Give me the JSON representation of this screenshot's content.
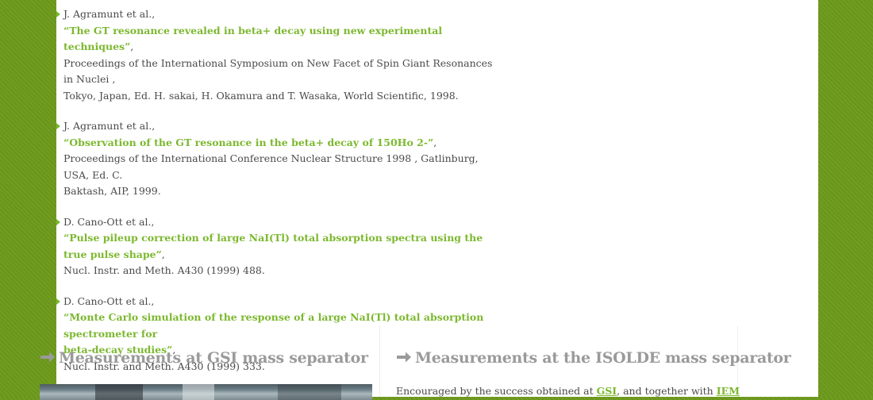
{
  "publications": [
    {
      "authors": "J. Agramunt et al.,",
      "title": "“The GT resonance revealed in beta+ decay using new experimental techniques”",
      "source_lines": [
        "Proceedings of the International Symposium on New Facet of Spin Giant Resonances in Nuclei ,",
        "Tokyo, Japan, Ed. H. sakai, H. Okamura and T. Wasaka, World Scientific, 1998."
      ]
    },
    {
      "authors": "J. Agramunt et al.,",
      "title": "“Observation of the GT resonance in the beta+ decay of 150Ho 2-”",
      "source_lines": [
        "Proceedings of the International Conference Nuclear Structure 1998 , Gatlinburg, USA, Ed. C.",
        "Baktash, AIP, 1999."
      ]
    },
    {
      "authors": "D. Cano-Ott et al.,",
      "title": "“Pulse pileup correction of large NaI(Tl) total absorption spectra using the true pulse shape”",
      "source_lines": [
        "Nucl. Instr. and Meth. A430 (1999) 488."
      ]
    },
    {
      "authors": "D. Cano-Ott et al.,",
      "title_lines": [
        "“Monte Carlo simulation of the response of a large NaI(Tl) total absorption spectrometer for",
        "beta-decay studies”"
      ],
      "source_lines": [
        "Nucl. Instr. and Meth. A430 (1999) 333."
      ]
    }
  ],
  "sections": {
    "left_title": "Measurements at GSI mass separator",
    "right_title": "Measurements at the ISOLDE mass separator",
    "right_text": {
      "before": "Encouraged by the success obtained at",
      "link1": "GSI",
      "middle": ", and together with",
      "link2": "IEM"
    }
  },
  "colors": {
    "background": "#6d9a1c",
    "accent": "#7cb82f",
    "heading": "#9a9a9a",
    "text": "#4a4a4a"
  }
}
